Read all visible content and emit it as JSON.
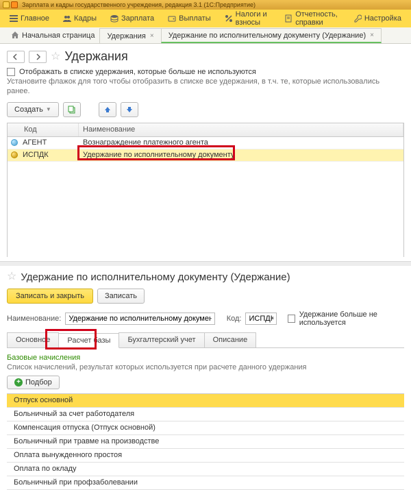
{
  "titlebar": "Зарплата и кадры государственного учреждения, редакция 3.1  (1С:Предприятие)",
  "menu": {
    "items": [
      {
        "icon": "menu",
        "label": "Главное"
      },
      {
        "icon": "people",
        "label": "Кадры"
      },
      {
        "icon": "coins",
        "label": "Зарплата"
      },
      {
        "icon": "wallet",
        "label": "Выплаты"
      },
      {
        "icon": "percent",
        "label": "Налоги и взносы"
      },
      {
        "icon": "doc",
        "label": "Отчетность, справки"
      },
      {
        "icon": "wrench",
        "label": "Настройка"
      }
    ]
  },
  "tabs": {
    "home": "Начальная страница",
    "items": [
      "Удержания",
      "Удержание по исполнительному документу (Удержание)"
    ],
    "active_index": 1
  },
  "upper": {
    "title": "Удержания",
    "show_unused_label": "Отображать в списке удержания, которые больше не используются",
    "hint": "Установите флажок для того чтобы отобразить в списке все удержания, в т.ч. те, которые использовались ранее.",
    "create_label": "Создать",
    "grid": {
      "headers": {
        "code": "Код",
        "name": "Наименование"
      },
      "rows": [
        {
          "code": "АГЕНТ",
          "name": "Вознаграждение платежного агента"
        },
        {
          "code": "ИСПДК",
          "name": "Удержание по исполнительному документу"
        }
      ],
      "selected": 1
    }
  },
  "lower": {
    "title": "Удержание по исполнительному документу (Удержание)",
    "buttons": {
      "save_close": "Записать и закрыть",
      "save": "Записать"
    },
    "fields": {
      "name_label": "Наименование:",
      "name_value": "Удержание по исполнительному документу",
      "code_label": "Код:",
      "code_value": "ИСПДК",
      "unused_label": "Удержание больше не используется"
    },
    "tabs": [
      "Основное",
      "Расчет базы",
      "Бухгалтерский учет",
      "Описание"
    ],
    "active_tab": 1,
    "section_label": "Базовые начисления",
    "section_hint": "Список начислений, результат которых используется при расчете данного удержания",
    "podbor_label": "Подбор",
    "accruals": [
      "Отпуск основной",
      "Больничный за счет работодателя",
      "Компенсация отпуска (Отпуск основной)",
      "Больничный при травме на производстве",
      "Оплата вынужденного простоя",
      "Оплата по окладу",
      "Больничный при профзаболевании"
    ]
  }
}
